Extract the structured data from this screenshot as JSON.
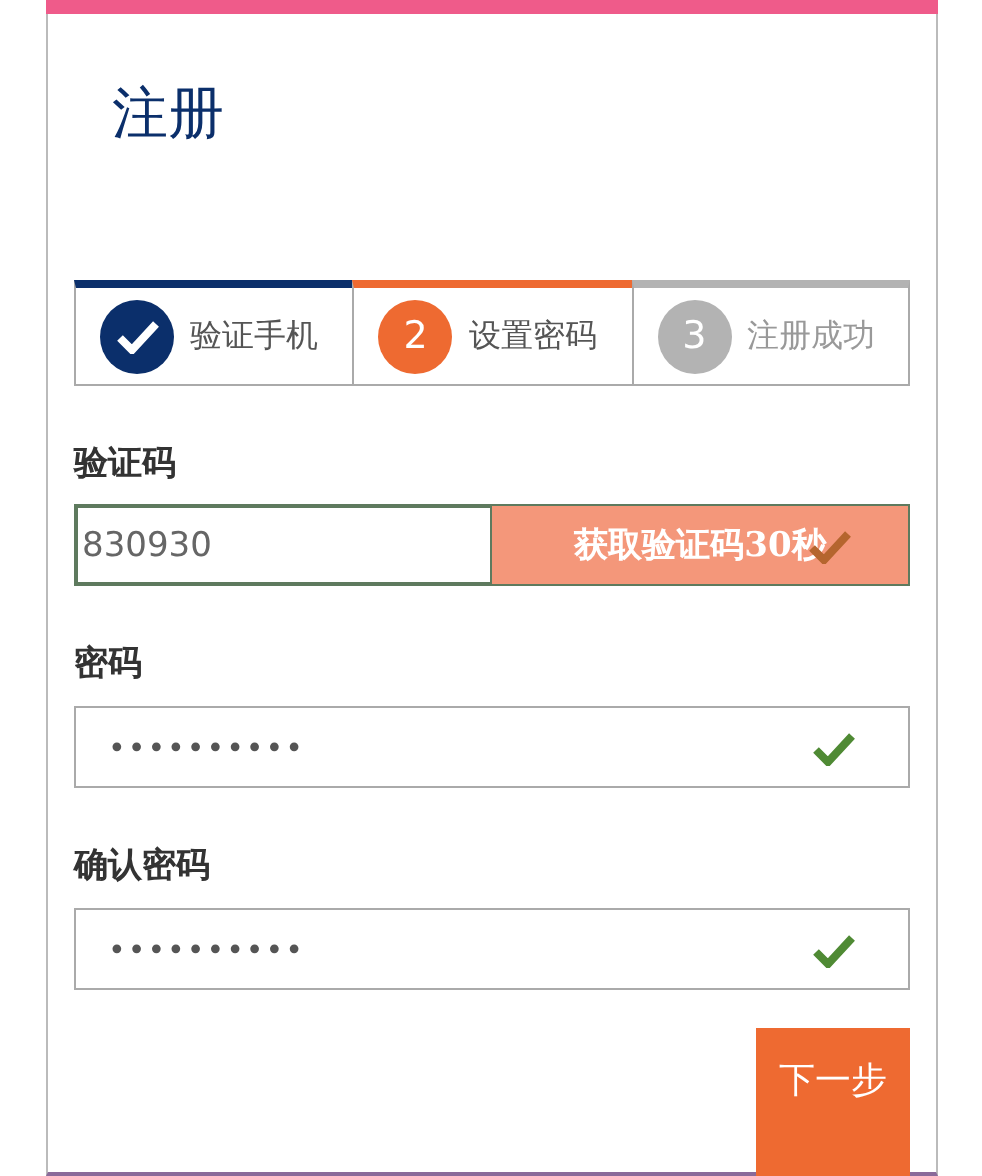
{
  "title": "注册",
  "steps": [
    {
      "label": "验证手机",
      "kind": "done"
    },
    {
      "number": "2",
      "label": "设置密码",
      "kind": "current"
    },
    {
      "number": "3",
      "label": "注册成功",
      "kind": "pending"
    }
  ],
  "code_field": {
    "label": "验证码",
    "value": "830930",
    "valid": true,
    "button": {
      "label": "获取验证码30秒",
      "disabled": true
    }
  },
  "fields": [
    {
      "label": "密码",
      "value": "••••••••••",
      "valid": true
    },
    {
      "label": "确认密码",
      "value": "••••••••••",
      "valid": true
    }
  ],
  "next_button": "下一步"
}
